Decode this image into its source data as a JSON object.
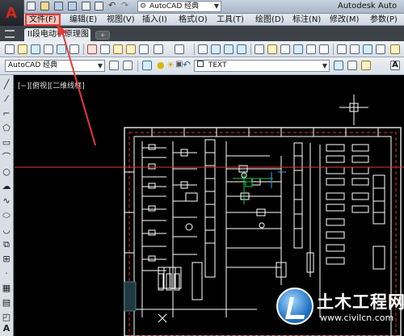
{
  "titlebar": {
    "workspace": "AutoCAD 经典",
    "app_title": "Autodesk Auto",
    "app_logo": "A"
  },
  "menu": {
    "items": [
      "文件(F)",
      "编辑(E)",
      "视图(V)",
      "插入(I)",
      "格式(O)",
      "工具(T)",
      "绘图(D)",
      "标注(N)",
      "修改(M)",
      "参数(P)"
    ]
  },
  "tabs": {
    "document": "II段电动机原理图*",
    "close_glyph": "×",
    "new_tab_glyph": "+"
  },
  "toolbar2": {
    "workspace": "AutoCAD 经典",
    "text_style": "TEXT"
  },
  "canvas": {
    "view_label": "[−][俯视][二维线框]"
  },
  "watermark": {
    "title": "土木工程网",
    "url": "www.civilcn.com"
  },
  "colors": {
    "highlight": "#e53935",
    "drawing_frame": "#ffffff",
    "background": "#000000"
  }
}
